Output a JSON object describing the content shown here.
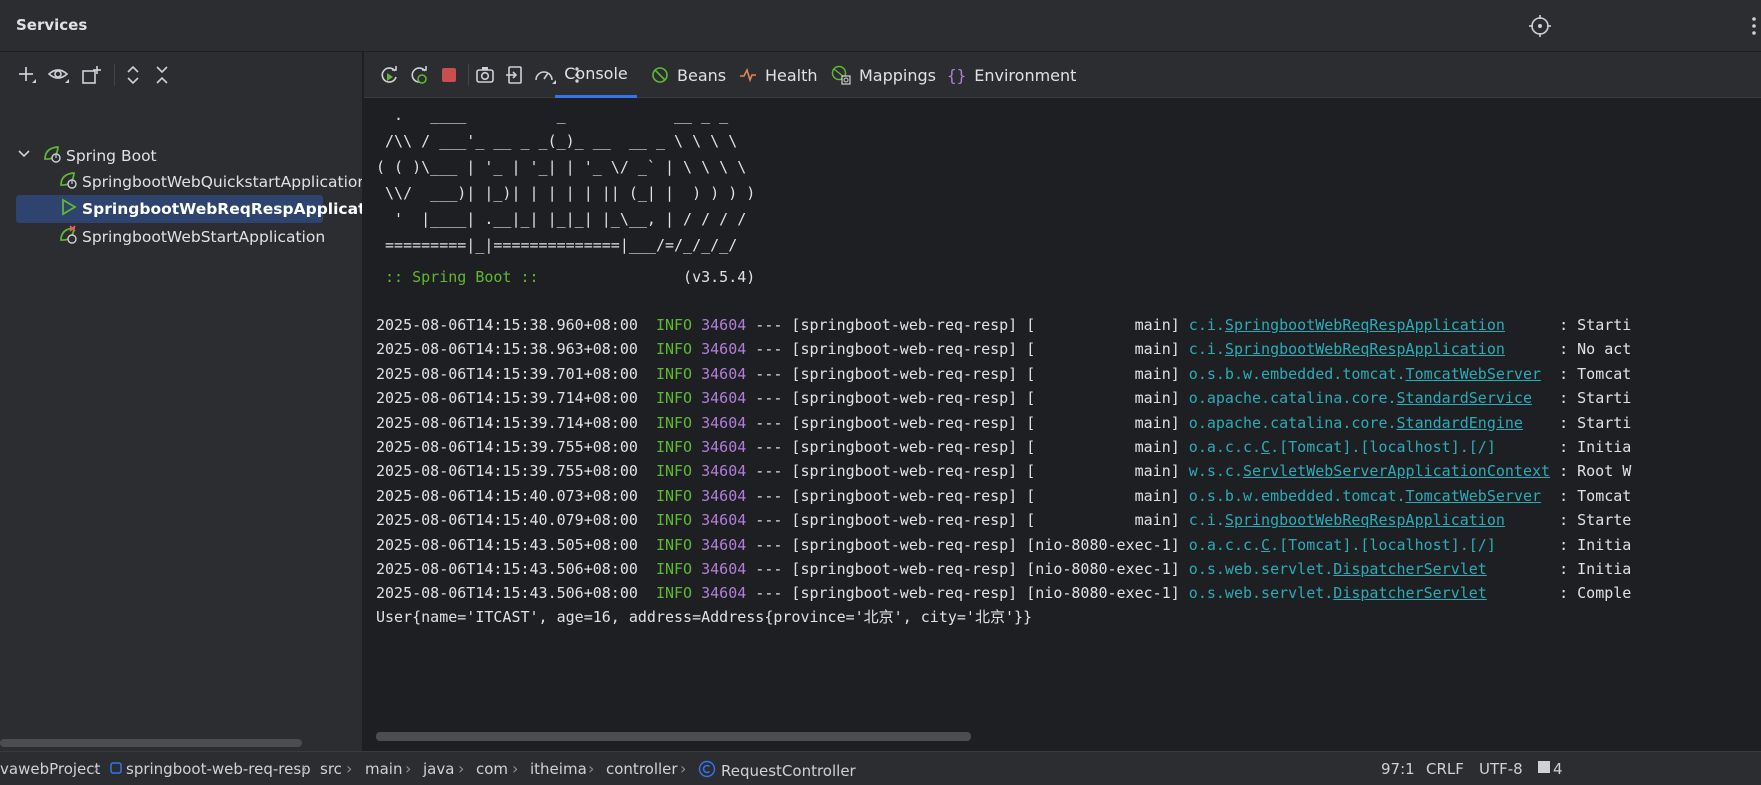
{
  "window": {
    "title": "Services"
  },
  "tree": {
    "group_label": "Spring Boot",
    "items": [
      {
        "label": "SpringbootWebQuickstartApplication"
      },
      {
        "label": "SpringbootWebReqRespApplication"
      },
      {
        "label": "SpringbootWebStartApplication"
      }
    ]
  },
  "tabs": [
    {
      "label": "Console",
      "icon": "console"
    },
    {
      "label": "Beans",
      "icon": "beans-icon"
    },
    {
      "label": "Health",
      "icon": "health-icon"
    },
    {
      "label": "Mappings",
      "icon": "mappings-icon"
    },
    {
      "label": "Environment",
      "icon": "environment-icon"
    }
  ],
  "console": {
    "banner": [
      "  .   ____          _            __ _ _",
      " /\\\\ / ___'_ __ _ _(_)_ __  __ _ \\ \\ \\ \\",
      "( ( )\\___ | '_ | '_| | '_ \\/ _` | \\ \\ \\ \\",
      " \\\\/  ___)| |_)| | | | | || (_| |  ) ) ) )",
      "  '  |____| .__|_| |_|_| |_\\__, | / / / /",
      " =========|_|==============|___/=/_/_/_/"
    ],
    "spring_label": " :: Spring Boot :: ",
    "spring_version": "               (v3.5.4)",
    "logs": [
      {
        "ts": "2025-08-06T14:15:38.960+08:00",
        "level": "INFO",
        "pid": "34604",
        "mid": " --- [springboot-web-req-resp] [           main] ",
        "pkg": "c.i.",
        "cls": "SpringbootWebReqRespApplication",
        "pad": "      ",
        "msg": ": Starti"
      },
      {
        "ts": "2025-08-06T14:15:38.963+08:00",
        "level": "INFO",
        "pid": "34604",
        "mid": " --- [springboot-web-req-resp] [           main] ",
        "pkg": "c.i.",
        "cls": "SpringbootWebReqRespApplication",
        "pad": "      ",
        "msg": ": No act"
      },
      {
        "ts": "2025-08-06T14:15:39.701+08:00",
        "level": "INFO",
        "pid": "34604",
        "mid": " --- [springboot-web-req-resp] [           main] ",
        "pkg": "o.s.b.w.embedded.tomcat.",
        "cls": "TomcatWebServer",
        "pad": "  ",
        "msg": ": Tomcat"
      },
      {
        "ts": "2025-08-06T14:15:39.714+08:00",
        "level": "INFO",
        "pid": "34604",
        "mid": " --- [springboot-web-req-resp] [           main] ",
        "pkg": "o.apache.catalina.core.",
        "cls": "StandardService",
        "pad": "   ",
        "msg": ": Starti"
      },
      {
        "ts": "2025-08-06T14:15:39.714+08:00",
        "level": "INFO",
        "pid": "34604",
        "mid": " --- [springboot-web-req-resp] [           main] ",
        "pkg": "o.apache.catalina.core.",
        "cls": "StandardEngine",
        "pad": "    ",
        "msg": ": Starti"
      },
      {
        "ts": "2025-08-06T14:15:39.755+08:00",
        "level": "INFO",
        "pid": "34604",
        "mid": " --- [springboot-web-req-resp] [           main] ",
        "pkg": "o.a.c.c.",
        "cls": "C",
        "pad": "",
        "rest": ".[Tomcat].[localhost].[/]       ",
        "msg": ": Initia"
      },
      {
        "ts": "2025-08-06T14:15:39.755+08:00",
        "level": "INFO",
        "pid": "34604",
        "mid": " --- [springboot-web-req-resp] [           main] ",
        "pkg": "w.s.c.",
        "cls": "ServletWebServerApplicationContext",
        "pad": " ",
        "msg": ": Root W"
      },
      {
        "ts": "2025-08-06T14:15:40.073+08:00",
        "level": "INFO",
        "pid": "34604",
        "mid": " --- [springboot-web-req-resp] [           main] ",
        "pkg": "o.s.b.w.embedded.tomcat.",
        "cls": "TomcatWebServer",
        "pad": "  ",
        "msg": ": Tomcat"
      },
      {
        "ts": "2025-08-06T14:15:40.079+08:00",
        "level": "INFO",
        "pid": "34604",
        "mid": " --- [springboot-web-req-resp] [           main] ",
        "pkg": "c.i.",
        "cls": "SpringbootWebReqRespApplication",
        "pad": "      ",
        "msg": ": Starte"
      },
      {
        "ts": "2025-08-06T14:15:43.505+08:00",
        "level": "INFO",
        "pid": "34604",
        "mid": " --- [springboot-web-req-resp] [nio-8080-exec-1] ",
        "pkg": "o.a.c.c.",
        "cls": "C",
        "pad": "",
        "rest": ".[Tomcat].[localhost].[/]       ",
        "msg": ": Initia"
      },
      {
        "ts": "2025-08-06T14:15:43.506+08:00",
        "level": "INFO",
        "pid": "34604",
        "mid": " --- [springboot-web-req-resp] [nio-8080-exec-1] ",
        "pkg": "o.s.web.servlet.",
        "cls": "DispatcherServlet",
        "pad": "        ",
        "msg": ": Initia"
      },
      {
        "ts": "2025-08-06T14:15:43.506+08:00",
        "level": "INFO",
        "pid": "34604",
        "mid": " --- [springboot-web-req-resp] [nio-8080-exec-1] ",
        "pkg": "o.s.web.servlet.",
        "cls": "DispatcherServlet",
        "pad": "        ",
        "msg": ": Comple"
      }
    ],
    "output": "User{name='ITCAST', age=16, address=Address{province='北京', city='北京'}}"
  },
  "statusbar": {
    "crumbs": [
      "vawebProject",
      "springboot-web-req-resp",
      "src",
      "main",
      "java",
      "com",
      "itheima",
      "controller",
      "RequestController"
    ],
    "position": "97:1",
    "line_ending": "CRLF",
    "encoding": "UTF-8",
    "indent": "4"
  },
  "colors": {
    "accent": "#3574f0",
    "info": "#5fb832",
    "pid": "#b17ed9",
    "logger": "#2aacb8"
  }
}
